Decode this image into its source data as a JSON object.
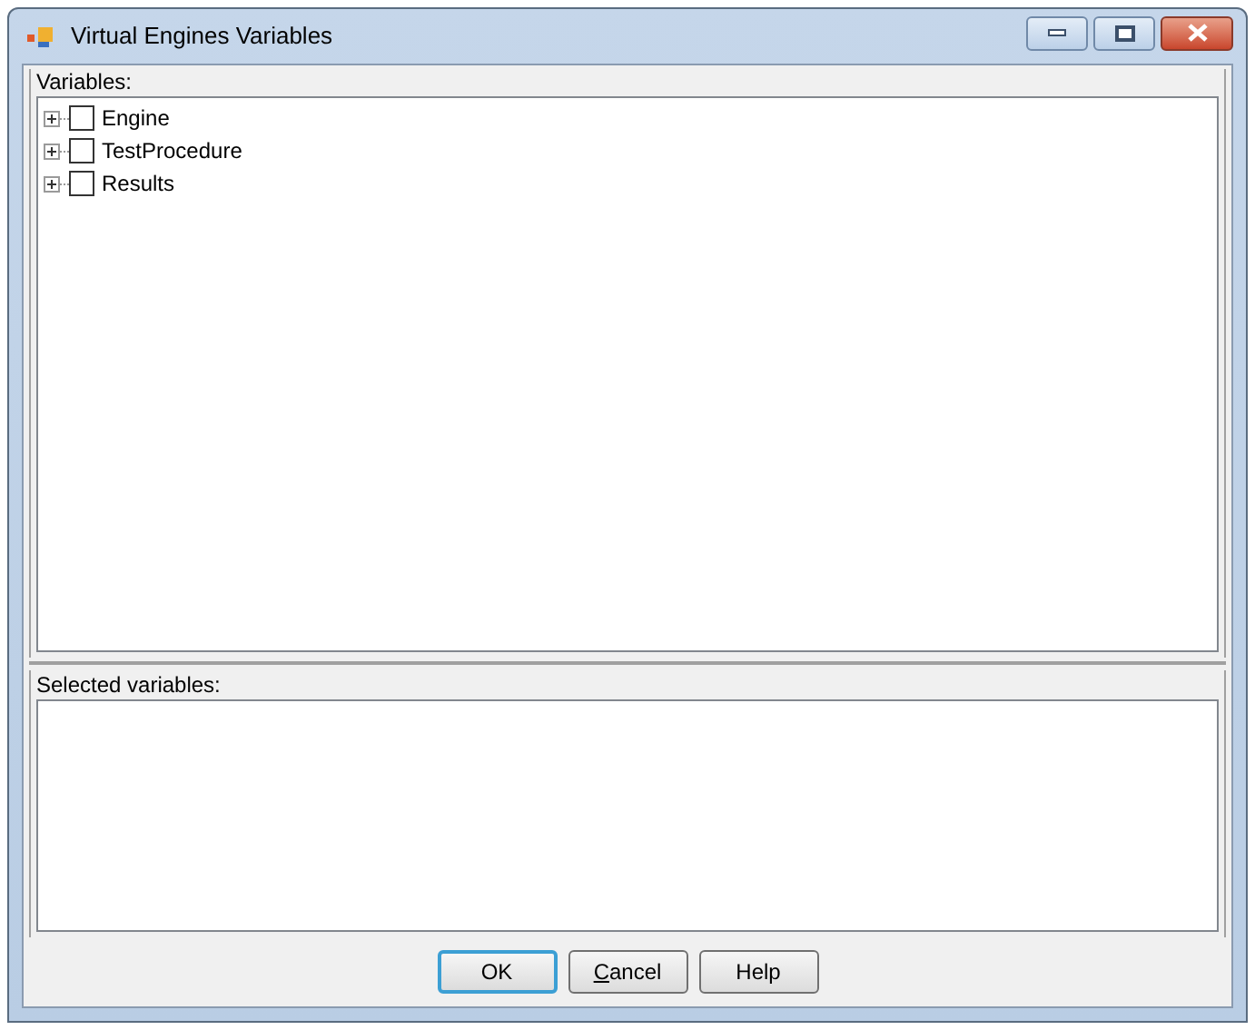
{
  "window": {
    "title": "Virtual Engines Variables"
  },
  "variables": {
    "label": "Variables:",
    "items": [
      {
        "label": "Engine",
        "expanded": false,
        "checked": false
      },
      {
        "label": "TestProcedure",
        "expanded": false,
        "checked": false
      },
      {
        "label": "Results",
        "expanded": false,
        "checked": false
      }
    ]
  },
  "selected_variables": {
    "label": "Selected variables:"
  },
  "buttons": [
    {
      "label": "OK",
      "default": true,
      "underline_first": false
    },
    {
      "label": "Cancel",
      "default": false,
      "underline_first": true
    },
    {
      "label": "Help",
      "default": false,
      "underline_first": false
    }
  ]
}
